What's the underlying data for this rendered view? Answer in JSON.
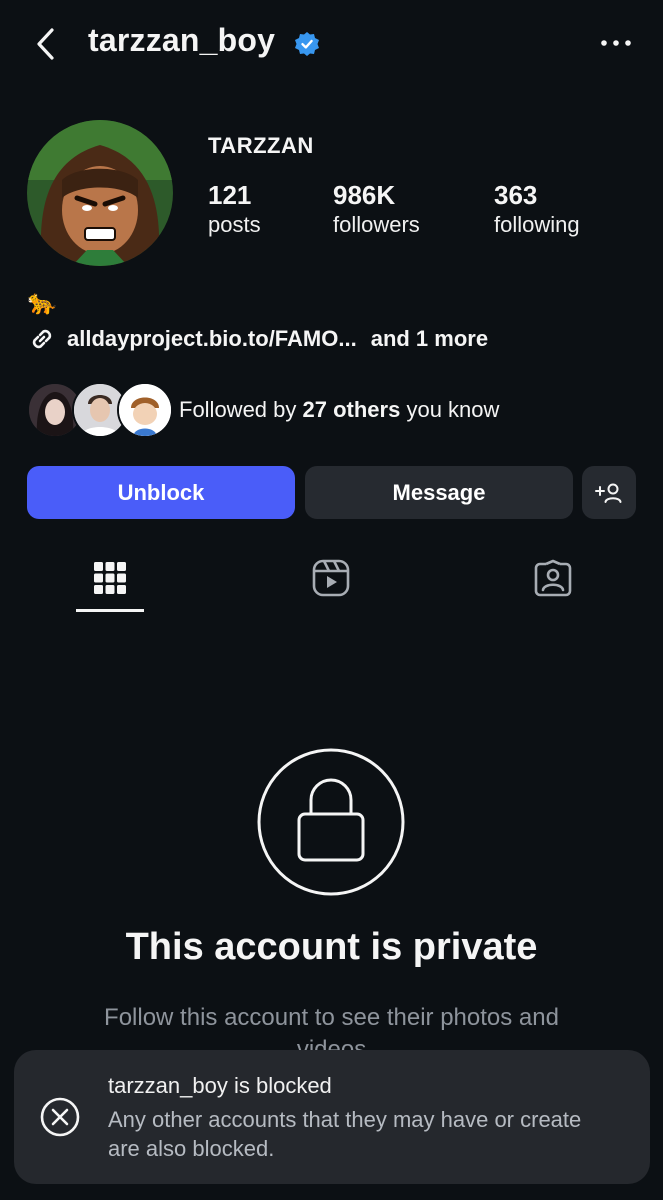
{
  "header": {
    "username": "tarzzan_boy",
    "verified": true,
    "back_icon": "chevron-left-icon",
    "more_icon": "more-horizontal-icon"
  },
  "profile": {
    "display_name": "TARZZAN",
    "stats": [
      {
        "value": "121",
        "label": "posts"
      },
      {
        "value": "986K",
        "label": "followers"
      },
      {
        "value": "363",
        "label": "following"
      }
    ],
    "bio_emoji": "🐆",
    "link": {
      "text": "alldayproject.bio.to/FAMO...",
      "more": "and 1 more"
    },
    "followed_by": {
      "prefix": "Followed by ",
      "count": "27 others",
      "suffix": " you know"
    }
  },
  "actions": {
    "unblock_label": "Unblock",
    "message_label": "Message"
  },
  "tabs": [
    "grid-icon",
    "reels-icon",
    "tagged-icon"
  ],
  "private": {
    "title": "This account is private",
    "subtitle": "Follow this account to see their photos and videos"
  },
  "toast": {
    "title": "tarzzan_boy is blocked",
    "body": "Any other accounts that they may have or create are also blocked."
  },
  "colors": {
    "background": "#0c1014",
    "primary_button": "#4a5df9",
    "secondary_button": "#262a30",
    "verified_badge": "#3897f0",
    "toast_background": "#25282d"
  }
}
